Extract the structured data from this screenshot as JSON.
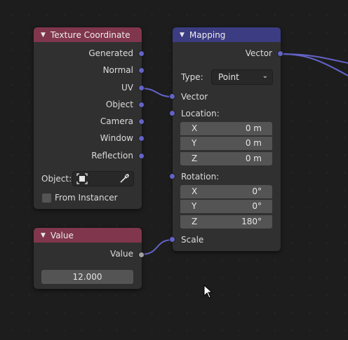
{
  "texture_coordinate": {
    "title": "Texture Coordinate",
    "outputs": [
      "Generated",
      "Normal",
      "UV",
      "Object",
      "Camera",
      "Window",
      "Reflection"
    ],
    "object_label": "Object:",
    "from_instancer_label": "From Instancer",
    "from_instancer_checked": false
  },
  "mapping": {
    "title": "Mapping",
    "output": "Vector",
    "type_label": "Type:",
    "type_value": "Point",
    "vector_label": "Vector",
    "location_label": "Location:",
    "location": [
      {
        "axis": "X",
        "value": "0 m"
      },
      {
        "axis": "Y",
        "value": "0 m"
      },
      {
        "axis": "Z",
        "value": "0 m"
      }
    ],
    "rotation_label": "Rotation:",
    "rotation": [
      {
        "axis": "X",
        "value": "0°"
      },
      {
        "axis": "Y",
        "value": "0°"
      },
      {
        "axis": "Z",
        "value": "180°"
      }
    ],
    "scale_label": "Scale"
  },
  "value_node": {
    "title": "Value",
    "output": "Value",
    "value": "12.000"
  },
  "colors": {
    "vector_socket": "#6363c7",
    "float_socket": "#a1a1a1",
    "texture_header": "#80364c",
    "mapping_header": "#3c3c83",
    "background": "#1d1d1d"
  }
}
